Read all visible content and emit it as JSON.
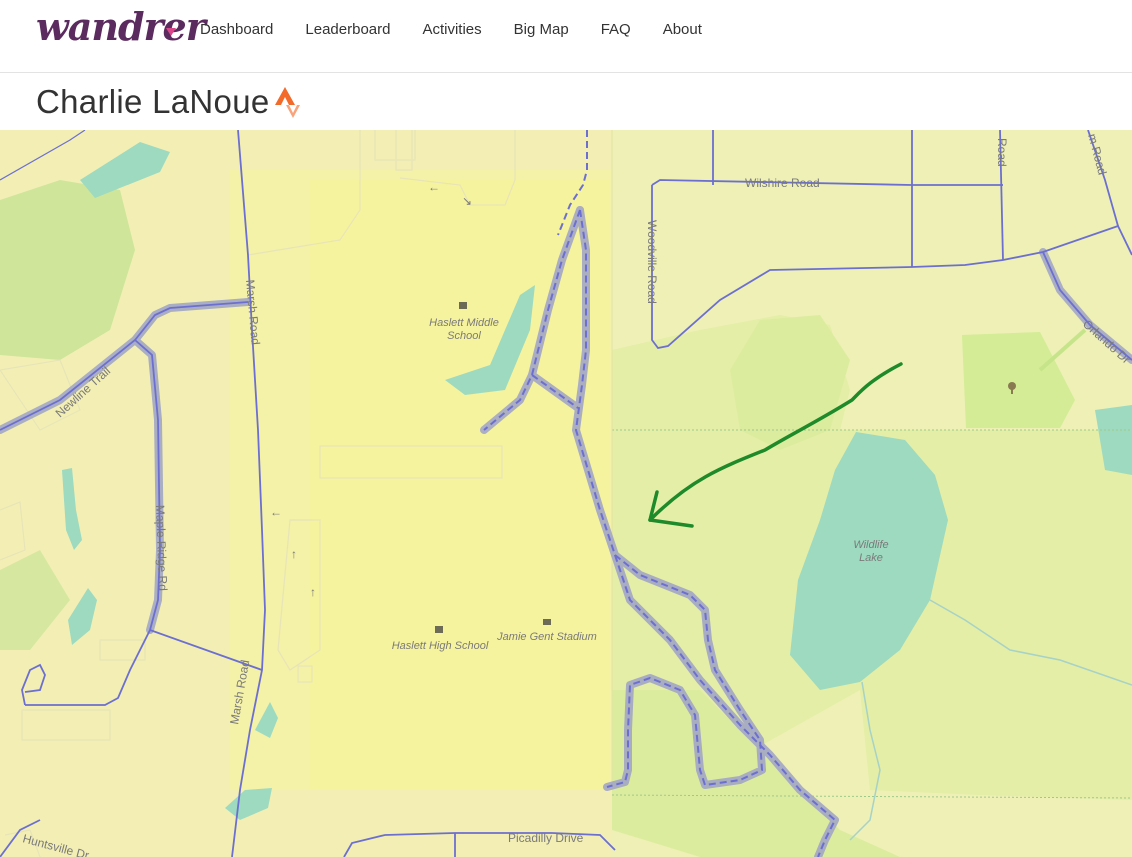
{
  "brand": {
    "logo_text": "wandrer",
    "accent_color": "#d9468a",
    "logo_color": "#5b2a5e"
  },
  "nav": {
    "items": [
      {
        "label": "Dashboard"
      },
      {
        "label": "Leaderboard"
      },
      {
        "label": "Activities"
      },
      {
        "label": "Big Map"
      },
      {
        "label": "FAQ"
      },
      {
        "label": "About"
      }
    ]
  },
  "page": {
    "title": "Charlie LaNoue",
    "strava_icon": "strava-icon"
  },
  "map": {
    "labels": {
      "wilshire": "Wilshire Road",
      "woodville": "Woodville Road",
      "marsh_upper": "Marsh Road",
      "marsh_lower": "Marsh Road",
      "newline": "Newline Trail",
      "maple_ridge": "Maple Ridge Rd",
      "orlando": "Orlando Dr",
      "picadilly": "Picadilly Drive",
      "huntsville": "Huntsville Dr",
      "top_road_a": "Road",
      "top_road_b": "m Road",
      "middle_school_1": "Haslett Middle",
      "middle_school_2": "School",
      "high_school": "Haslett High School",
      "stadium": "Jamie Gent Stadium",
      "lake_1": "Wildlife",
      "lake_2": "Lake"
    },
    "colors": {
      "road": "#6c6fd0",
      "ridden_halo": "#a3a7c4",
      "water": "#9ddac0",
      "park": "#d4ec96",
      "school": "#f3f1b2",
      "annotation": "#1e8a2a"
    }
  }
}
